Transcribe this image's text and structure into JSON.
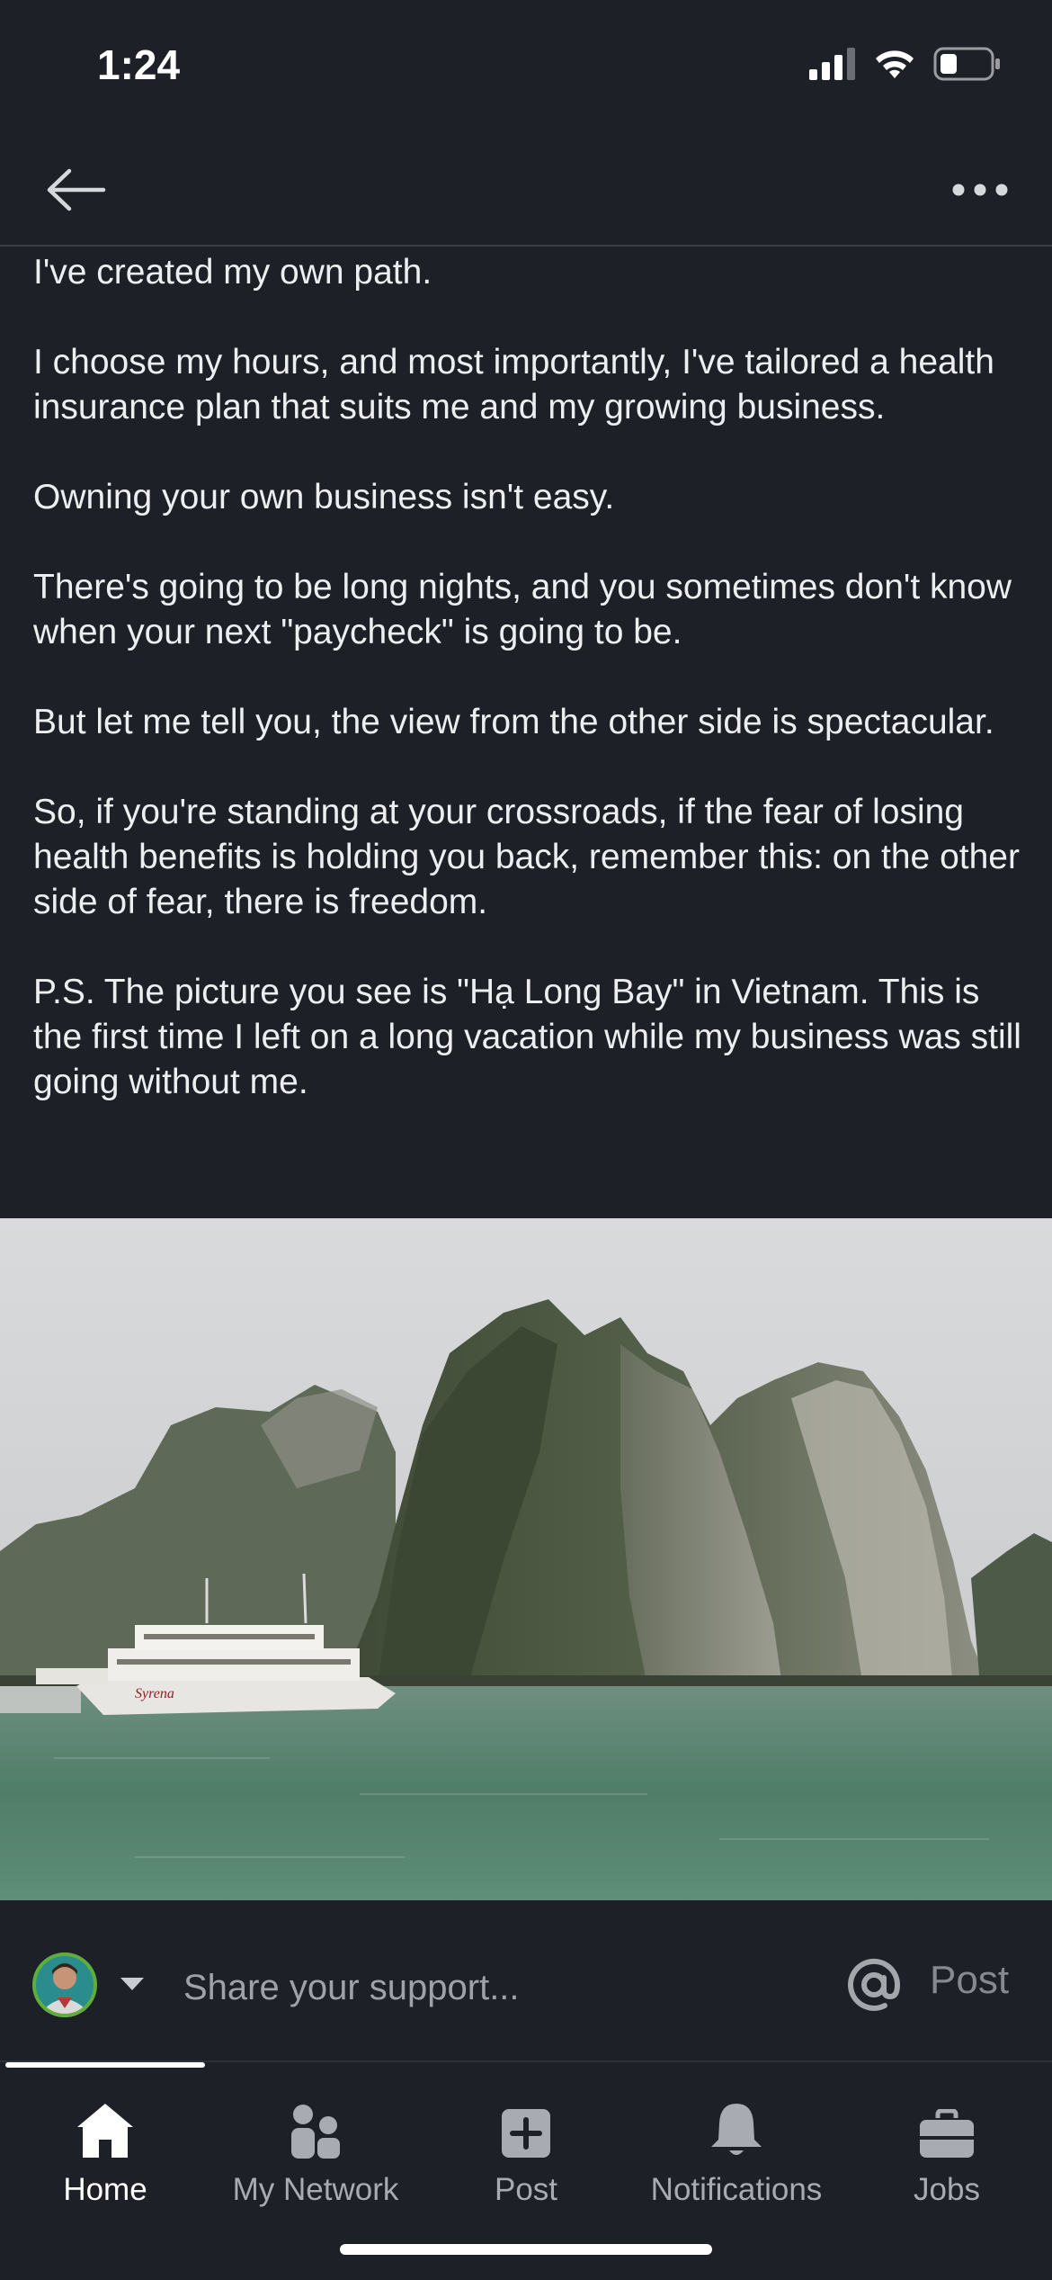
{
  "status_bar": {
    "time": "1:24"
  },
  "post": {
    "paragraphs": [
      "I've created my own path.",
      "I choose my hours, and most importantly, I've tailored a health insurance plan that suits me and my growing business.",
      "Owning your own business isn't easy.",
      "There's going to be long nights, and you sometimes don't know when your next \"paycheck\" is going to be.",
      "But let me tell you, the view from the other side is spectacular.",
      "So, if you're standing at your crossroads, if the fear of losing health benefits is holding you back, remember this: on the other side of fear, there is freedom.",
      "P.S. The picture you see is \"Hạ Long Bay\" in Vietnam. This is the first time I left on a long vacation while my business was still going without me."
    ],
    "boat_name": "Syrena"
  },
  "comment": {
    "placeholder": "Share your support...",
    "post_label": "Post"
  },
  "tabs": [
    {
      "label": "Home",
      "icon": "home-icon",
      "active": true
    },
    {
      "label": "My Network",
      "icon": "network-icon",
      "active": false
    },
    {
      "label": "Post",
      "icon": "plus-square-icon",
      "active": false
    },
    {
      "label": "Notifications",
      "icon": "bell-icon",
      "active": false
    },
    {
      "label": "Jobs",
      "icon": "briefcase-icon",
      "active": false
    }
  ],
  "colors": {
    "background": "#1d2026",
    "text": "#eceef0",
    "muted": "#a8acb2",
    "water": "#5d8a74",
    "sky": "#cfd1d3"
  }
}
